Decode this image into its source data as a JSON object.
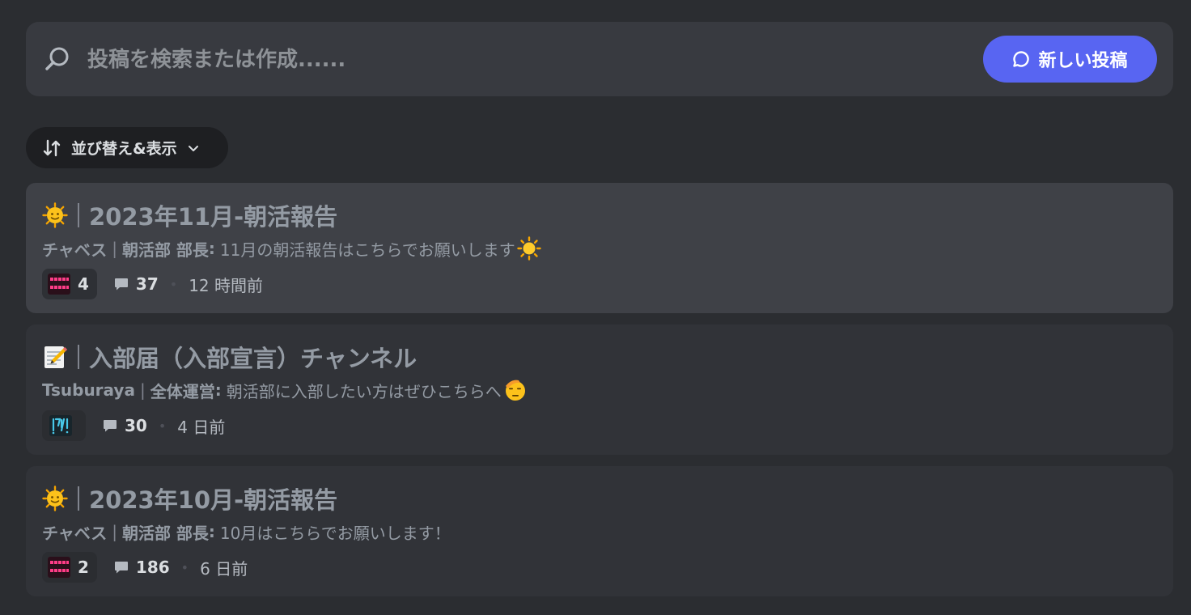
{
  "search": {
    "placeholder": "投稿を検索または作成......"
  },
  "new_post": {
    "label": "新しい投稿"
  },
  "sort": {
    "label": "並び替え&表示"
  },
  "posts": [
    {
      "emoji": "sun-face-icon",
      "title": "2023年11月-朝活報告",
      "author": "チャベス",
      "role": "朝活部 部長",
      "colon": ":",
      "preview": "11月の朝活報告はこちらでお願いします",
      "preview_emoji": "sun-icon",
      "reaction": {
        "icon": "arigatou-gozaimasu-sticker-icon",
        "count": "4"
      },
      "comments": "37",
      "time": "12 時間前"
    },
    {
      "emoji": "memo-icon",
      "title": "入部届（入部宣言）チャンネル",
      "author": "Tsuburaya",
      "role": "全体運営",
      "colon": ":",
      "preview": "朝活部に入部したい方はぜひこちらへ",
      "preview_emoji": "saluting-face-icon",
      "reaction": {
        "icon": "iine-sticker-icon",
        "count": ""
      },
      "comments": "30",
      "time": "4 日前"
    },
    {
      "emoji": "sun-face-icon",
      "title": "2023年10月-朝活報告",
      "author": "チャベス",
      "role": "朝活部 部長",
      "colon": ":",
      "preview": "10月はこちらでお願いします！",
      "preview_emoji": "",
      "reaction": {
        "icon": "arigatou-gozaimasu-sticker-icon",
        "count": "2"
      },
      "comments": "186",
      "time": "6 日前"
    }
  ],
  "colors": {
    "accent": "#5865f2",
    "background": "#2b2d31",
    "card": "#313338",
    "card_hover": "#3f4147"
  }
}
